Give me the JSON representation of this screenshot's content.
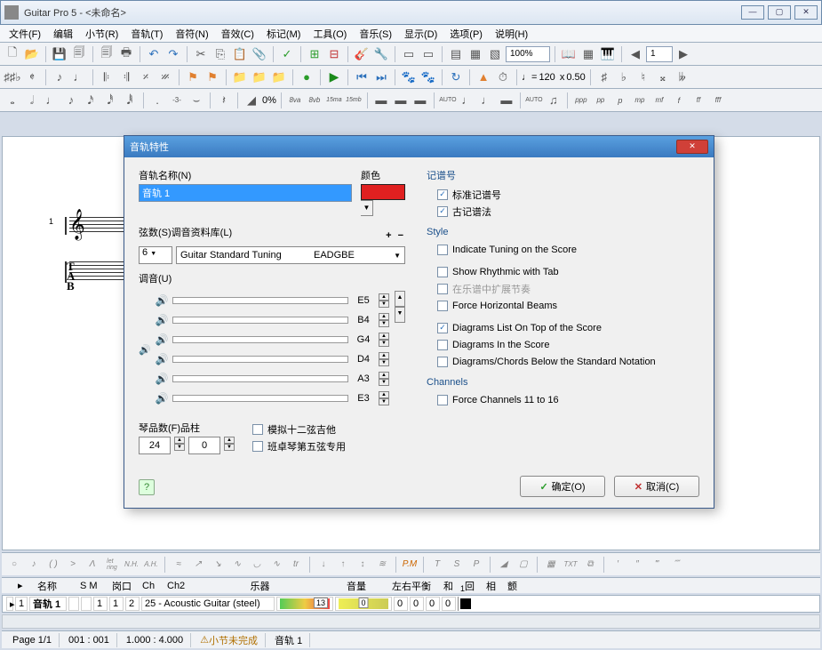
{
  "window": {
    "title": "Guitar Pro 5 - <未命名>"
  },
  "menu": [
    "文件(F)",
    "编辑",
    "小节(R)",
    "音轨(T)",
    "音符(N)",
    "音效(C)",
    "标记(M)",
    "工具(O)",
    "音乐(S)",
    "显示(D)",
    "选项(P)",
    "说明(H)"
  ],
  "toolbar1": {
    "zoom": "100%",
    "page": "1"
  },
  "toolbar2": {
    "tempo": "120",
    "speed": "0.50"
  },
  "toolbar3": {
    "percent": "0%"
  },
  "dialog": {
    "title": "音轨特性",
    "labels": {
      "trackName": "音轨名称(N)",
      "color": "颜色",
      "strings": "弦数(S)调音资料库(L)",
      "tuning": "调音(U)",
      "frets": "琴品数(F)品柱",
      "twelveString": "模拟十二弦吉他",
      "banjo": "班卓琴第五弦专用"
    },
    "trackNameValue": "音轨 1",
    "stringCount": "6",
    "tuningPreset": "Guitar Standard Tuning",
    "tuningShort": "EADGBE",
    "stringNotes": [
      "E5",
      "B4",
      "G4",
      "D4",
      "A3",
      "E3"
    ],
    "fretsValue": "24",
    "capoValue": "0",
    "sections": {
      "notation": "记谱号",
      "style": "Style",
      "channels": "Channels"
    },
    "checks": {
      "standardNotation": "标准记谱号",
      "tablature": "古记谱法",
      "indicateTuning": "Indicate Tuning on the Score",
      "showRhythmic": "Show Rhythmic with Tab",
      "extendRhythm": "在乐谱中扩展节奏",
      "forceHorizontal": "Force Horizontal Beams",
      "diagramsTop": "Diagrams List On Top of the Score",
      "diagramsInScore": "Diagrams In the Score",
      "diagramsBelow": "Diagrams/Chords Below the Standard Notation",
      "forceChannels": "Force Channels 11 to 16"
    },
    "buttons": {
      "ok": "确定(O)",
      "cancel": "取消(C)"
    }
  },
  "trackHeader": {
    "name": "名称",
    "sm": "S M",
    "port": "岗口",
    "ch": "Ch",
    "ch2": "Ch2",
    "instrument": "乐器",
    "volume": "音量",
    "pan": "左右平衡",
    "rev": "和",
    "cho": "回",
    "pha": "相",
    "tre": "颤"
  },
  "trackRow": {
    "num": "1",
    "name": "音轨 1",
    "port": "1",
    "ch": "1",
    "ch2": "2",
    "instrument": "25 - Acoustic Guitar (steel)",
    "volume": "13",
    "pan": "0",
    "rev": "0",
    "cho": "0",
    "pha": "0",
    "tre": "0",
    "timelineNum": "1"
  },
  "status": {
    "page": "Page 1/1",
    "pos": "001 : 001",
    "time": "1.000 : 4.000",
    "warn": "小节未完成",
    "track": "音轨 1"
  }
}
